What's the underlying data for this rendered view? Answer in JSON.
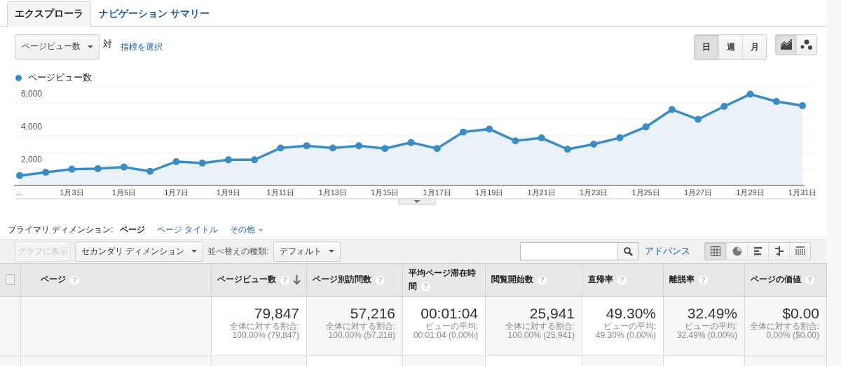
{
  "tabs": [
    {
      "label": "エクスプローラ",
      "selected": true
    },
    {
      "label": "ナビゲーション サマリー",
      "selected": false
    }
  ],
  "metric_selector": {
    "value": "ページビュー数",
    "versus": "対",
    "select_link": "指標を選択"
  },
  "period_buttons": [
    {
      "label": "日",
      "selected": true
    },
    {
      "label": "週",
      "selected": false
    },
    {
      "label": "月",
      "selected": false
    }
  ],
  "chart_type_buttons": [
    {
      "kind": "line",
      "selected": true
    },
    {
      "kind": "motion",
      "selected": false
    }
  ],
  "chart_data": {
    "type": "area",
    "categories": [
      "…",
      null,
      "1月3日",
      null,
      "1月5日",
      null,
      "1月7日",
      null,
      "1月9日",
      null,
      "1月11日",
      null,
      "1月13日",
      null,
      "1月15日",
      null,
      "1月17日",
      null,
      "1月19日",
      null,
      "1月21日",
      null,
      "1月23日",
      null,
      "1月25日",
      null,
      "1月27日",
      null,
      "1月29日",
      null,
      "1月31日"
    ],
    "series": [
      {
        "name": "ページビュー数",
        "color": "#3b8cc4",
        "values": [
          600,
          800,
          990,
          1020,
          1120,
          860,
          1450,
          1360,
          1560,
          1560,
          2280,
          2410,
          2280,
          2410,
          2250,
          2610,
          2250,
          3250,
          3430,
          2710,
          2890,
          2200,
          2510,
          2900,
          3560,
          4620,
          4020,
          4810,
          5550,
          5110,
          4850
        ]
      }
    ],
    "ylim": [
      0,
      6000
    ],
    "yticks": [
      {
        "value": 2000,
        "label": "2,000"
      },
      {
        "value": 4000,
        "label": "4,000"
      },
      {
        "value": 6000,
        "label": "6,000"
      }
    ]
  },
  "primary_dimension": {
    "label": "プライマリ ディメンション:",
    "options": [
      {
        "label": "ページ",
        "selected": true,
        "kind": "option"
      },
      {
        "label": "ページ タイトル",
        "selected": false,
        "kind": "option"
      },
      {
        "label": "その他",
        "selected": false,
        "kind": "menu"
      }
    ]
  },
  "toolbar": {
    "plot_button": {
      "label": "グラフに表示",
      "disabled": true
    },
    "secondary_dimension": "セカンダリ ディメンション",
    "sort_label": "並べ替えの種類:",
    "sort_value": "デフォルト",
    "advanced_link": "アドバンス",
    "view_buttons": [
      {
        "kind": "table",
        "selected": true
      },
      {
        "kind": "pie",
        "selected": false
      },
      {
        "kind": "performance",
        "selected": false
      },
      {
        "kind": "comparison",
        "selected": false
      },
      {
        "kind": "pivot",
        "selected": false
      }
    ]
  },
  "table": {
    "select_all_checked": false,
    "columns": [
      {
        "label": "ページ",
        "help": "?",
        "sorted": false
      },
      {
        "label": "ページビュー数",
        "help": "?",
        "sorted": true
      },
      {
        "label": "ページ別訪問数",
        "help": "?",
        "sorted": false
      },
      {
        "label": "平均ページ滞在時間",
        "help": "?",
        "sorted": false
      },
      {
        "label": "閲覧開始数",
        "help": "?",
        "sorted": false
      },
      {
        "label": "直帰率",
        "help": "?",
        "sorted": false
      },
      {
        "label": "離脱率",
        "help": "?",
        "sorted": false
      },
      {
        "label": "ページの価値",
        "help": "?",
        "sorted": false
      }
    ],
    "totals": [
      {
        "value": "79,847",
        "caption": "全体に対する割合:",
        "detail": "100.00% (79,847)"
      },
      {
        "value": "57,216",
        "caption": "全体に対する割合:",
        "detail": "100.00% (57,216)"
      },
      {
        "value": "00:01:04",
        "caption": "ビューの平均:",
        "detail": "00:01:04 (0.00%)"
      },
      {
        "value": "25,941",
        "caption": "全体に対する割合:",
        "detail": "100.00% (25,941)"
      },
      {
        "value": "49.30%",
        "caption": "ビューの平均:",
        "detail": "49.30% (0.00%)"
      },
      {
        "value": "32.49%",
        "caption": "ビューの平均:",
        "detail": "32.49% (0.00%)"
      },
      {
        "value": "$0.00",
        "caption": "全体に対する割合:",
        "detail": "0.00% ($0.00)"
      }
    ]
  }
}
